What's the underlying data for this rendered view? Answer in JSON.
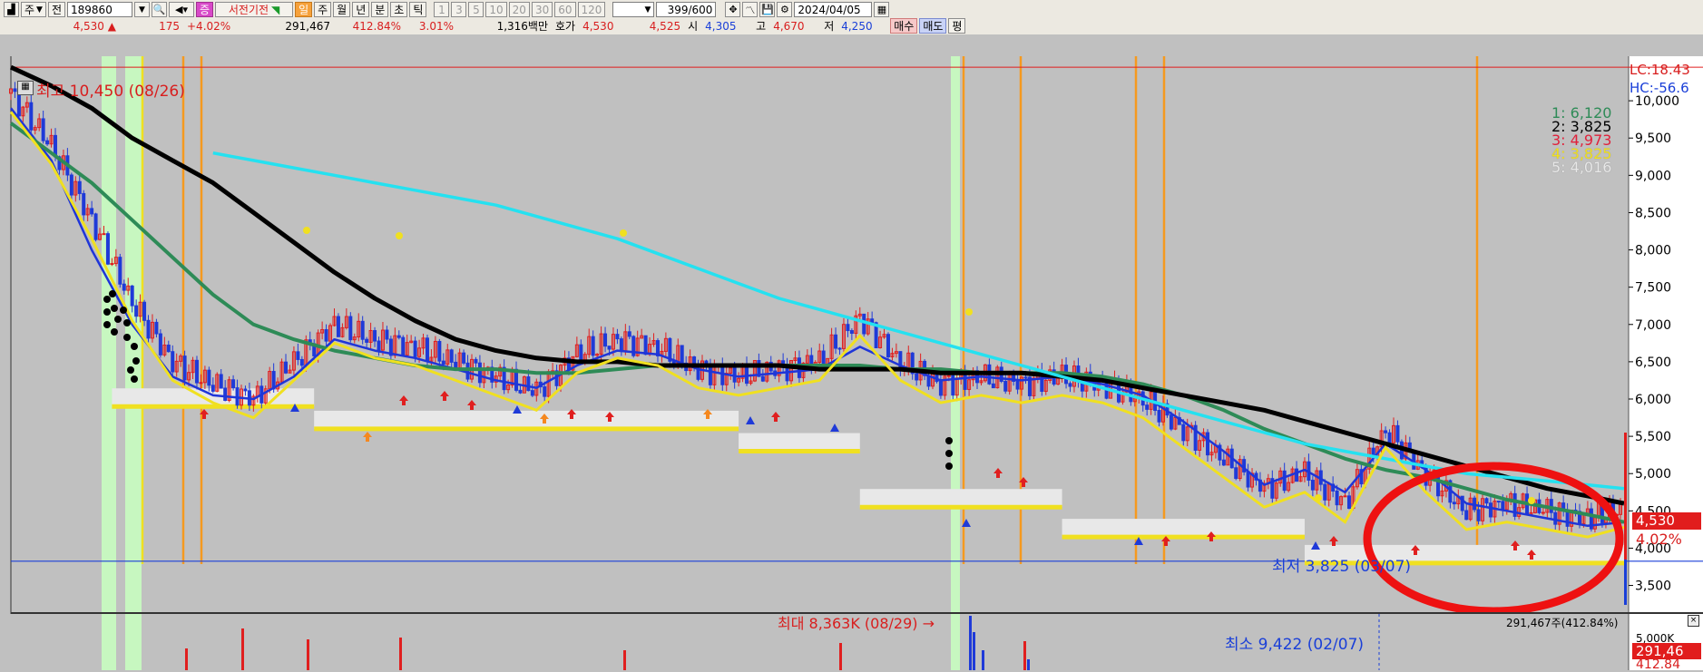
{
  "toolbar": {
    "period_weekly": "주",
    "prev_label": "전",
    "stock_code": "189860",
    "stock_name": "서전기전",
    "badge_label": "증",
    "intervals": [
      "일",
      "주",
      "월",
      "년",
      "분",
      "초",
      "틱"
    ],
    "active_interval": "일",
    "minute_steps": [
      "1",
      "3",
      "5",
      "10",
      "20",
      "30",
      "60",
      "120"
    ],
    "count_value": "399",
    "count_total": "/600",
    "date_value": "2024/04/05"
  },
  "quote": {
    "price": "4,530",
    "arrow": "▲",
    "change": "175",
    "change_pct": "+4.02%",
    "volume": "291,467",
    "volume_ratio": "412.84%",
    "turnover": "3.01%",
    "amount": "1,316백만",
    "ask_label": "호가",
    "ask_price": "4,530",
    "bid_price": "4,525",
    "open_label": "시",
    "open_price": "4,305",
    "high_label": "고",
    "high_price": "4,670",
    "low_label": "저",
    "low_price": "4,250",
    "buy_label": "매수",
    "sell_label": "매도",
    "eval_label": "평"
  },
  "chart": {
    "high_annotation": "최고 10,450 (08/26)",
    "low_annotation": "최저 3,825 (03/07)",
    "volume_max_annotation": "최대 8,363K (08/29) →",
    "volume_min_annotation": "최소 9,422 (02/07)",
    "volume_current_label": "291,467주(412.84%)",
    "lc_label": "LC:18.43",
    "hc_label": "HC:-56.6",
    "price_box": "4,530",
    "pct_box": "4.02%",
    "vol_box": "291,46",
    "vol_pct_box": "412.84",
    "vol_axis_label": "5,000K",
    "legend": [
      {
        "label": "1: 6,120",
        "color": "#2e8b57"
      },
      {
        "label": "2: 3,825",
        "color": "#000000"
      },
      {
        "label": "3: 4,973",
        "color": "#e0203a"
      },
      {
        "label": "4: 3,825",
        "color": "#f0e020"
      },
      {
        "label": "5: 4,016",
        "color": "#e8e8e8"
      }
    ],
    "y_ticks": [
      "10,000",
      "9,500",
      "9,000",
      "8,500",
      "8,000",
      "7,500",
      "7,000",
      "6,500",
      "6,000",
      "5,500",
      "5,000",
      "4,500",
      "4,000",
      "3,500"
    ]
  },
  "chart_data": {
    "type": "line",
    "y_axis": {
      "min": 3300,
      "max": 10500,
      "ticks": [
        10000,
        9500,
        9000,
        8500,
        8000,
        7500,
        7000,
        6500,
        6000,
        5500,
        5000,
        4500,
        4000,
        3500
      ]
    },
    "x": [
      0,
      10,
      20,
      30,
      40,
      50,
      60,
      70,
      80,
      90,
      100,
      110,
      120,
      130,
      140,
      150,
      160,
      170,
      180,
      190,
      200,
      210,
      220,
      230,
      240,
      250,
      260,
      270,
      280,
      290,
      300,
      310,
      320,
      330,
      340,
      350,
      360,
      370,
      380,
      390,
      399
    ],
    "close": [
      10100,
      9400,
      8400,
      7300,
      6500,
      6200,
      6000,
      6500,
      7000,
      6800,
      6700,
      6500,
      6300,
      6100,
      6600,
      6800,
      6700,
      6400,
      6300,
      6400,
      6500,
      7100,
      6500,
      6200,
      6300,
      6200,
      6300,
      6200,
      6000,
      5600,
      5200,
      4800,
      5000,
      4600,
      5600,
      5000,
      4500,
      4600,
      4500,
      4400,
      4530
    ],
    "series": [
      {
        "name": "MA 20",
        "color": "#1f35d8",
        "values": [
          9900,
          9200,
          8000,
          7000,
          6300,
          6050,
          6000,
          6300,
          6800,
          6650,
          6550,
          6400,
          6250,
          6150,
          6450,
          6650,
          6600,
          6400,
          6300,
          6350,
          6400,
          6700,
          6450,
          6250,
          6300,
          6250,
          6300,
          6200,
          6050,
          5700,
          5300,
          4850,
          5050,
          4750,
          5400,
          5050,
          4600,
          4500,
          4400,
          4300,
          4350
        ]
      },
      {
        "name": "MA 60",
        "color": "#2e8b57",
        "values": [
          9700,
          9300,
          8900,
          8400,
          7900,
          7400,
          7000,
          6800,
          6650,
          6550,
          6450,
          6400,
          6400,
          6350,
          6350,
          6400,
          6450,
          6450,
          6450,
          6450,
          6450,
          6450,
          6400,
          6400,
          6350,
          6350,
          6350,
          6300,
          6200,
          6050,
          5850,
          5600,
          5400,
          5200,
          5050,
          4950,
          4800,
          4650,
          4550,
          4450,
          4350
        ]
      },
      {
        "name": "MA 120",
        "color": "#000000",
        "values": [
          10450,
          10200,
          9900,
          9500,
          9200,
          8900,
          8500,
          8100,
          7700,
          7350,
          7050,
          6800,
          6650,
          6550,
          6500,
          6500,
          6450,
          6450,
          6450,
          6450,
          6400,
          6400,
          6400,
          6350,
          6350,
          6350,
          6300,
          6250,
          6150,
          6050,
          5950,
          5850,
          5700,
          5550,
          5400,
          5250,
          5100,
          4950,
          4800,
          4700,
          4600
        ]
      },
      {
        "name": "MA 240",
        "color": "#25e1f0",
        "values": [
          null,
          null,
          null,
          null,
          null,
          9300,
          9200,
          9100,
          9000,
          8900,
          8800,
          8700,
          8600,
          8450,
          8300,
          8150,
          7950,
          7750,
          7550,
          7350,
          7200,
          7050,
          6900,
          6750,
          6600,
          6450,
          6300,
          6150,
          6000,
          5850,
          5700,
          5550,
          5400,
          5300,
          5200,
          5100,
          5000,
          4950,
          4900,
          4850,
          4800
        ]
      }
    ],
    "support_steps": [
      {
        "x1": 25,
        "x2": 75,
        "y": 5900
      },
      {
        "x1": 75,
        "x2": 180,
        "y": 5600
      },
      {
        "x1": 180,
        "x2": 210,
        "y": 5300
      },
      {
        "x1": 210,
        "x2": 260,
        "y": 4550
      },
      {
        "x1": 260,
        "x2": 320,
        "y": 4150
      },
      {
        "x1": 320,
        "x2": 399,
        "y": 3800
      }
    ],
    "high_line": 10450,
    "low_line": 3825,
    "vertical_markers": [
      42,
      46,
      80,
      260,
      266,
      296,
      360,
      366,
      382,
      418
    ]
  }
}
